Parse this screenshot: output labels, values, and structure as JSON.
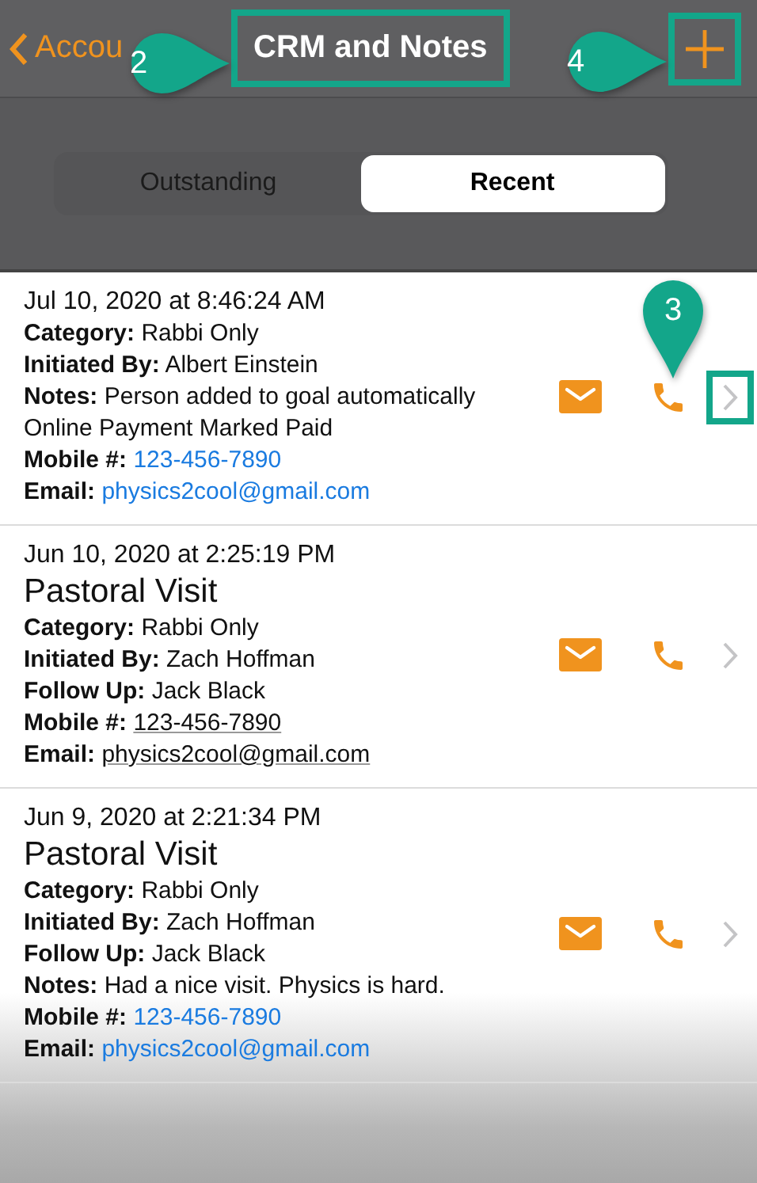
{
  "nav": {
    "back_label": "Accou",
    "title": {
      "text": "CRM and Notes",
      "highlighted": true,
      "callout": "2"
    },
    "add_button": {
      "highlighted": true,
      "callout": "4"
    }
  },
  "segments": [
    {
      "label": "Outstanding",
      "selected": false
    },
    {
      "label": "Recent",
      "selected": true
    }
  ],
  "entries": [
    {
      "date": "Jul 10, 2020 at 8:46:24 AM",
      "chevron_highlighted": true,
      "callout": "3",
      "fields": [
        {
          "label": "Category:",
          "value": "Rabbi Only",
          "kind": "plain"
        },
        {
          "label": "Initiated By:",
          "value": "Albert Einstein",
          "kind": "plain"
        },
        {
          "label": "Notes:",
          "value": "Person added to goal automatically",
          "continuation": "Online Payment Marked Paid",
          "kind": "plain"
        },
        {
          "label": "Mobile #:",
          "value": "123-456-7890",
          "kind": "link"
        },
        {
          "label": "Email:",
          "value": "physics2cool@gmail.com",
          "kind": "link"
        }
      ]
    },
    {
      "date": "Jun 10, 2020 at 2:25:19 PM",
      "title": "Pastoral Visit",
      "chevron_highlighted": false,
      "fields": [
        {
          "label": "Category:",
          "value": "Rabbi Only",
          "kind": "plain"
        },
        {
          "label": "Initiated By:",
          "value": "Zach Hoffman",
          "kind": "plain"
        },
        {
          "label": "Follow Up:",
          "value": "Jack Black",
          "kind": "plain"
        },
        {
          "label": "Mobile #:",
          "value": "123-456-7890",
          "kind": "underlined"
        },
        {
          "label": "Email:",
          "value": "physics2cool@gmail.com",
          "kind": "underlined"
        }
      ]
    },
    {
      "date": "Jun 9, 2020 at 2:21:34 PM",
      "title": "Pastoral Visit",
      "chevron_highlighted": false,
      "fields": [
        {
          "label": "Category:",
          "value": "Rabbi Only",
          "kind": "plain"
        },
        {
          "label": "Initiated By:",
          "value": "Zach Hoffman",
          "kind": "plain"
        },
        {
          "label": "Follow Up:",
          "value": "Jack Black",
          "kind": "plain"
        },
        {
          "label": "Notes:",
          "value": "Had a nice visit. Physics is hard.",
          "kind": "plain"
        },
        {
          "label": "Mobile #:",
          "value": "123-456-7890",
          "kind": "link"
        },
        {
          "label": "Email:",
          "value": "physics2cool@gmail.com",
          "kind": "link"
        }
      ]
    }
  ]
}
